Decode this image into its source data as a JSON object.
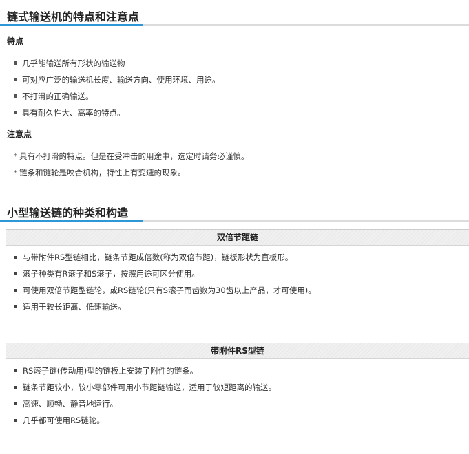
{
  "features_section": {
    "title": "链式输送机的特点和注意点",
    "features": {
      "title": "特点",
      "items": [
        "几乎能输送所有形状的输送物",
        "可对应广泛的输送机长度、输送方向、使用环境、用途。",
        "不打滑的正确输送。",
        "具有耐久性大、高率的特点。"
      ]
    },
    "notes": {
      "title": "注意点",
      "items": [
        "具有不打滑的特点。但是在受冲击的用途中，选定时请务必谨慎。",
        "链条和链轮是咬合机构，特性上有变速的现象。"
      ]
    }
  },
  "types_section": {
    "title": "小型输送链的种类和构造",
    "cards": [
      {
        "header": "双倍节距链",
        "items": [
          "与带附件RS型链相比，链条节距成倍数(称为双倍节距)，链板形状为直板形。",
          "滚子种类有R滚子和S滚子，按照用途可区分使用。",
          "可使用双倍节距型链轮，或RS链轮(只有S滚子而齿数为30齿以上产品，才可使用)。",
          "适用于较长距离、低速输送。"
        ]
      },
      {
        "header": "带附件RS型链",
        "items": [
          "RS滚子链(传动用)型的链板上安装了附件的链条。",
          "链条节距较小，较小零部件可用小节距链输送，适用于较短距离的输送。",
          "高速、顺畅、静音地运行。",
          "几乎都可使用RS链轮。"
        ]
      }
    ]
  }
}
